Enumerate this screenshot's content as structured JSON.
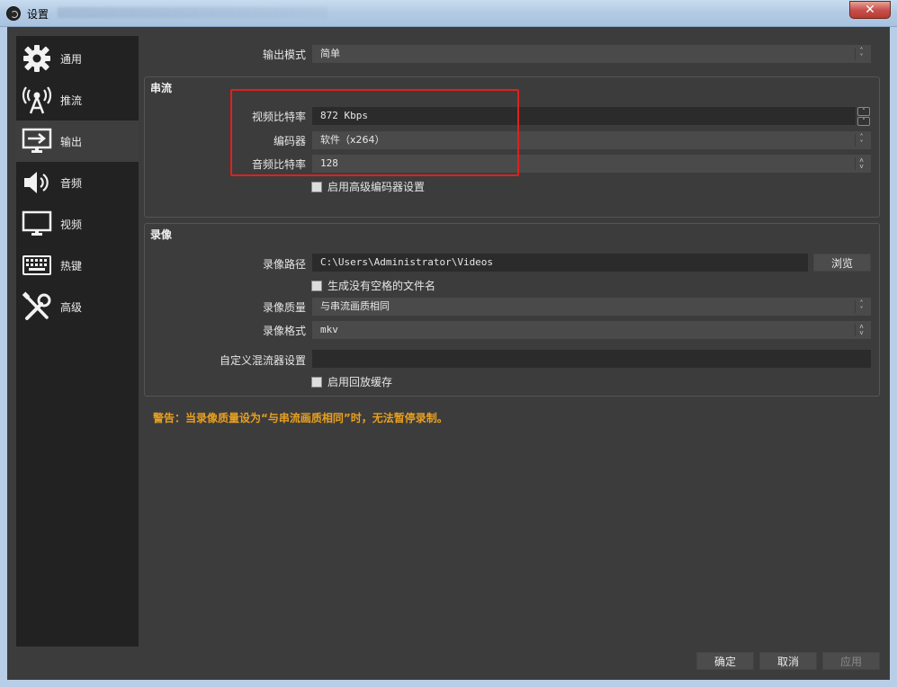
{
  "window": {
    "title": "设置",
    "close_glyph": "✕"
  },
  "sidebar": {
    "items": [
      {
        "label": "通用",
        "icon": "gear-icon"
      },
      {
        "label": "推流",
        "icon": "broadcast-antenna-icon"
      },
      {
        "label": "输出",
        "icon": "monitor-arrow-icon",
        "active": true
      },
      {
        "label": "音频",
        "icon": "speaker-icon"
      },
      {
        "label": "视频",
        "icon": "monitor-icon"
      },
      {
        "label": "热键",
        "icon": "keyboard-icon"
      },
      {
        "label": "高级",
        "icon": "tools-icon"
      }
    ]
  },
  "output_mode": {
    "label": "输出模式",
    "value": "简单"
  },
  "streaming": {
    "title": "串流",
    "video_bitrate_label": "视频比特率",
    "video_bitrate_value": "872 Kbps",
    "encoder_label": "编码器",
    "encoder_value": "软件（x264）",
    "audio_bitrate_label": "音频比特率",
    "audio_bitrate_value": "128",
    "advanced_encoder_label": "启用高级编码器设置"
  },
  "recording": {
    "title": "录像",
    "path_label": "录像路径",
    "path_value": "C:\\Users\\Administrator\\Videos",
    "browse_label": "浏览",
    "no_space_label": "生成没有空格的文件名",
    "quality_label": "录像质量",
    "quality_value": "与串流画质相同",
    "format_label": "录像格式",
    "format_value": "mkv",
    "muxer_label": "自定义混流器设置",
    "muxer_value": "",
    "replay_buffer_label": "启用回放缓存"
  },
  "warning": "警告：当录像质量设为“与串流画质相同”时，无法暂停录制。",
  "footer": {
    "ok_label": "确定",
    "cancel_label": "取消",
    "apply_label": "应用"
  },
  "colors": {
    "warning": "#e8a020",
    "highlight": "#e02020",
    "panel": "#3c3c3c",
    "sidebar": "#222222"
  }
}
